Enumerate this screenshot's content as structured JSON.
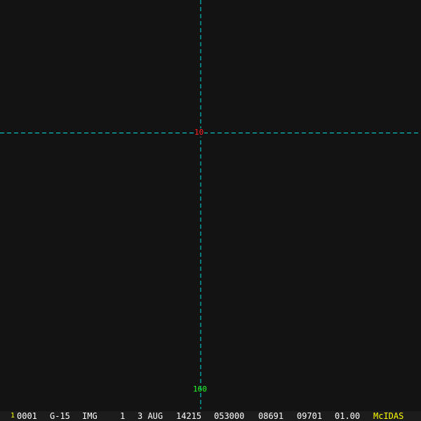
{
  "overlay": {
    "latitude_label": "10",
    "longitude_label": "160",
    "grid_color": "#00e0e0",
    "latitude_color": "#ff2020",
    "longitude_color": "#20ff20"
  },
  "status_bar": {
    "frame_number": "1",
    "fields": [
      "0001",
      "G-15",
      "IMG",
      "1",
      "3 AUG",
      "14215",
      "053000",
      "08691",
      "09701",
      "01.00"
    ],
    "brand": "McIDAS",
    "brand_color": "#ffff00"
  }
}
